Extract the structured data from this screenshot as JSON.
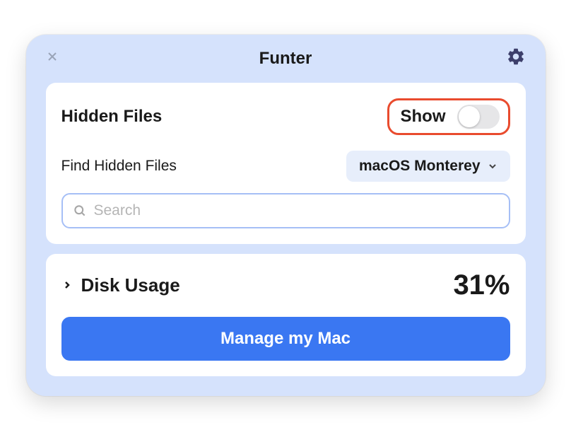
{
  "header": {
    "title": "Funter"
  },
  "mainPanel": {
    "hiddenFilesLabel": "Hidden Files",
    "showLabel": "Show",
    "findHiddenFilesLabel": "Find Hidden Files",
    "volumeDropdown": {
      "selected": "macOS Monterey"
    },
    "search": {
      "placeholder": "Search",
      "value": ""
    }
  },
  "diskPanel": {
    "diskUsageLabel": "Disk Usage",
    "percent": "31%",
    "manageButton": "Manage my Mac"
  }
}
